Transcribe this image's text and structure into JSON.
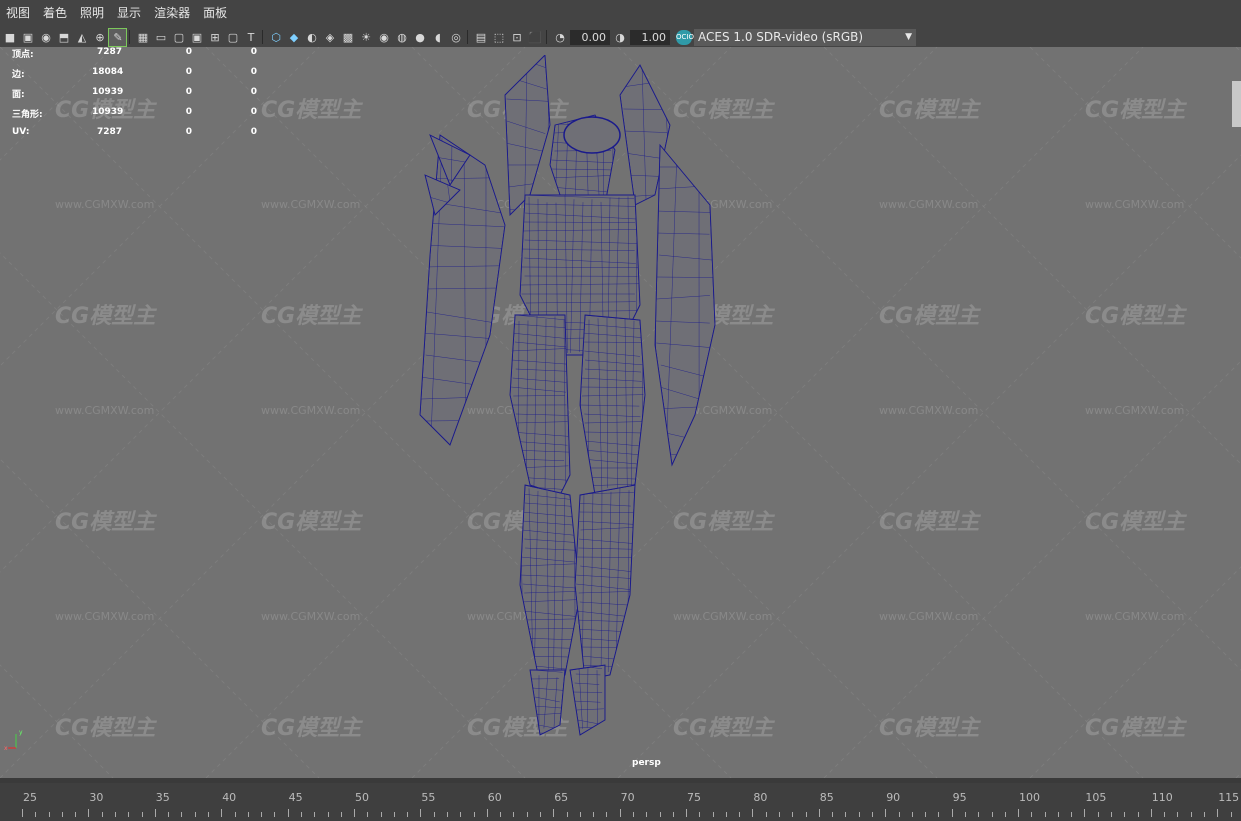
{
  "menu": [
    "视图",
    "着色",
    "照明",
    "显示",
    "渲染器",
    "面板"
  ],
  "toolbar": {
    "icons": [
      "camera-select-icon",
      "camera-lock-icon",
      "camera-attributes-icon",
      "bookmark-icon",
      "image-plane-icon",
      "2d-pan-zoom-icon",
      "grease-pencil-icon",
      "grid-icon",
      "film-gate-icon",
      "resolution-gate-icon",
      "gate-mask-icon",
      "field-chart-icon",
      "safe-action-icon",
      "safe-title-icon",
      "wireframe-icon",
      "smooth-shade-icon",
      "default-material-icon",
      "wireframe-on-shaded-icon",
      "xray-icon",
      "use-all-lights-icon",
      "shadows-icon",
      "screen-space-ao-icon",
      "motion-blur-icon",
      "multisample-aa-icon",
      "depth-of-field-icon",
      "isolate-select-icon",
      "xray-joints-icon",
      "xray-active-icon",
      "camera-fit-icon",
      "exposure-icon",
      "gamma-icon"
    ],
    "exposure": "0.00",
    "gamma": "1.00",
    "ocio_badge": "OCIO",
    "color_space": "ACES 1.0 SDR-video (sRGB)"
  },
  "hud": {
    "rows": [
      {
        "label": "顶点:",
        "a": "7287",
        "b": "0",
        "c": "0"
      },
      {
        "label": "边:",
        "a": "18084",
        "b": "0",
        "c": "0"
      },
      {
        "label": "面:",
        "a": "10939",
        "b": "0",
        "c": "0"
      },
      {
        "label": "三角形:",
        "a": "10939",
        "b": "0",
        "c": "0"
      },
      {
        "label": "UV:",
        "a": "7287",
        "b": "0",
        "c": "0"
      }
    ]
  },
  "watermark": {
    "logo": "CG模型主",
    "url": "www.CGMXW.com"
  },
  "camera_label": "persp",
  "axis": {
    "x": "x",
    "y": "y"
  },
  "timeline": {
    "ticks": [
      "25",
      "30",
      "35",
      "40",
      "45",
      "50",
      "55",
      "60",
      "65",
      "70",
      "75",
      "80",
      "85",
      "90",
      "95",
      "100",
      "105",
      "110",
      "115"
    ]
  },
  "colors": {
    "wire": "#1a1a8c",
    "viewport": "#727272",
    "active_outline": "#7cc85b"
  }
}
